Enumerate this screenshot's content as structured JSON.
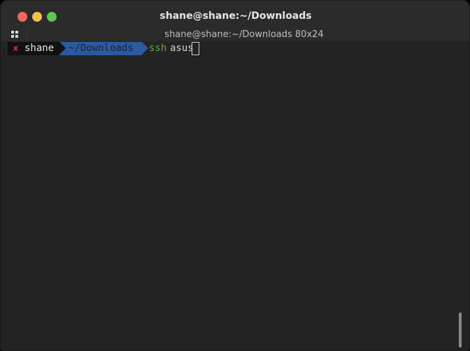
{
  "window": {
    "title": "shane@shane:~/Downloads"
  },
  "tab": {
    "title": "shane@shane:~/Downloads 80x24"
  },
  "prompt": {
    "status_symbol": "✘",
    "user": "shane",
    "directory": "~/Downloads"
  },
  "input": {
    "command": "ssh",
    "argument": "asus"
  },
  "colors": {
    "close": "#ed6a5e",
    "minimize": "#f4bf4f",
    "maximize": "#61c554",
    "status_error": "#d7323a",
    "directory_segment": "#2b5b9f",
    "command": "#64a545"
  },
  "icons": {
    "tab_menu": "grid-icon"
  }
}
